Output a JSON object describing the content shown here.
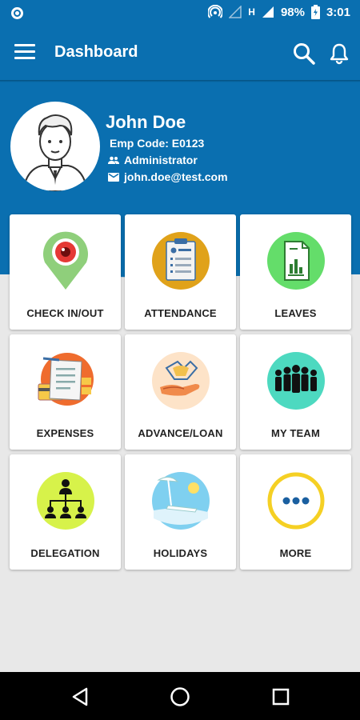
{
  "statusbar": {
    "battery": "98%",
    "time": "3:01",
    "network": "H"
  },
  "appbar": {
    "title": "Dashboard"
  },
  "profile": {
    "name": "John Doe",
    "emp_code": "Emp Code: E0123",
    "role": "Administrator",
    "email": "john.doe@test.com"
  },
  "tiles": [
    {
      "label": "CHECK IN/OUT",
      "icon": "location-pin-icon"
    },
    {
      "label": "ATTENDANCE",
      "icon": "clipboard-icon"
    },
    {
      "label": "LEAVES",
      "icon": "document-icon"
    },
    {
      "label": "EXPENSES",
      "icon": "receipt-icon"
    },
    {
      "label": "ADVANCE/LOAN",
      "icon": "hand-money-icon"
    },
    {
      "label": "MY TEAM",
      "icon": "team-icon"
    },
    {
      "label": "DELEGATION",
      "icon": "org-chart-icon"
    },
    {
      "label": "HOLIDAYS",
      "icon": "beach-icon"
    },
    {
      "label": "MORE",
      "icon": "more-dots-icon"
    }
  ],
  "colors": {
    "primary": "#0a6fb0",
    "background": "#e8e8e8",
    "accent_green": "#64dd6a",
    "accent_yellow": "#f5d024"
  }
}
